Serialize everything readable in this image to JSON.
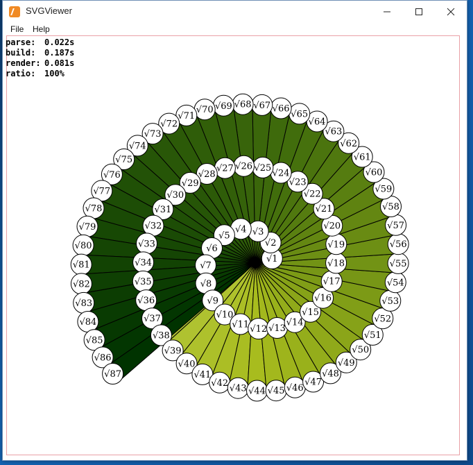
{
  "window": {
    "title": "SVGViewer",
    "icon": "svgviewer-app-icon",
    "controls": [
      "minimize-icon",
      "maximize-icon",
      "close-icon"
    ]
  },
  "menu": {
    "file": "File",
    "help": "Help"
  },
  "stats": [
    {
      "label": "parse:",
      "value": "0.022s"
    },
    {
      "label": "build:",
      "value": "0.187s"
    },
    {
      "label": "render:",
      "value": "0.081s"
    },
    {
      "label": "ratio:",
      "value": "100%"
    }
  ],
  "spiral": {
    "description_of_content": "Spiral of Theodorus",
    "count": 87,
    "label_prefix": "√",
    "colors": {
      "lightest": "#f7f9e8",
      "light_green": "#c8d66a",
      "mid_green": "#a8bc1e",
      "dark_green": "#3f6b0c",
      "darkest": "#003300",
      "canvas_border": "#e9a0a6"
    }
  }
}
